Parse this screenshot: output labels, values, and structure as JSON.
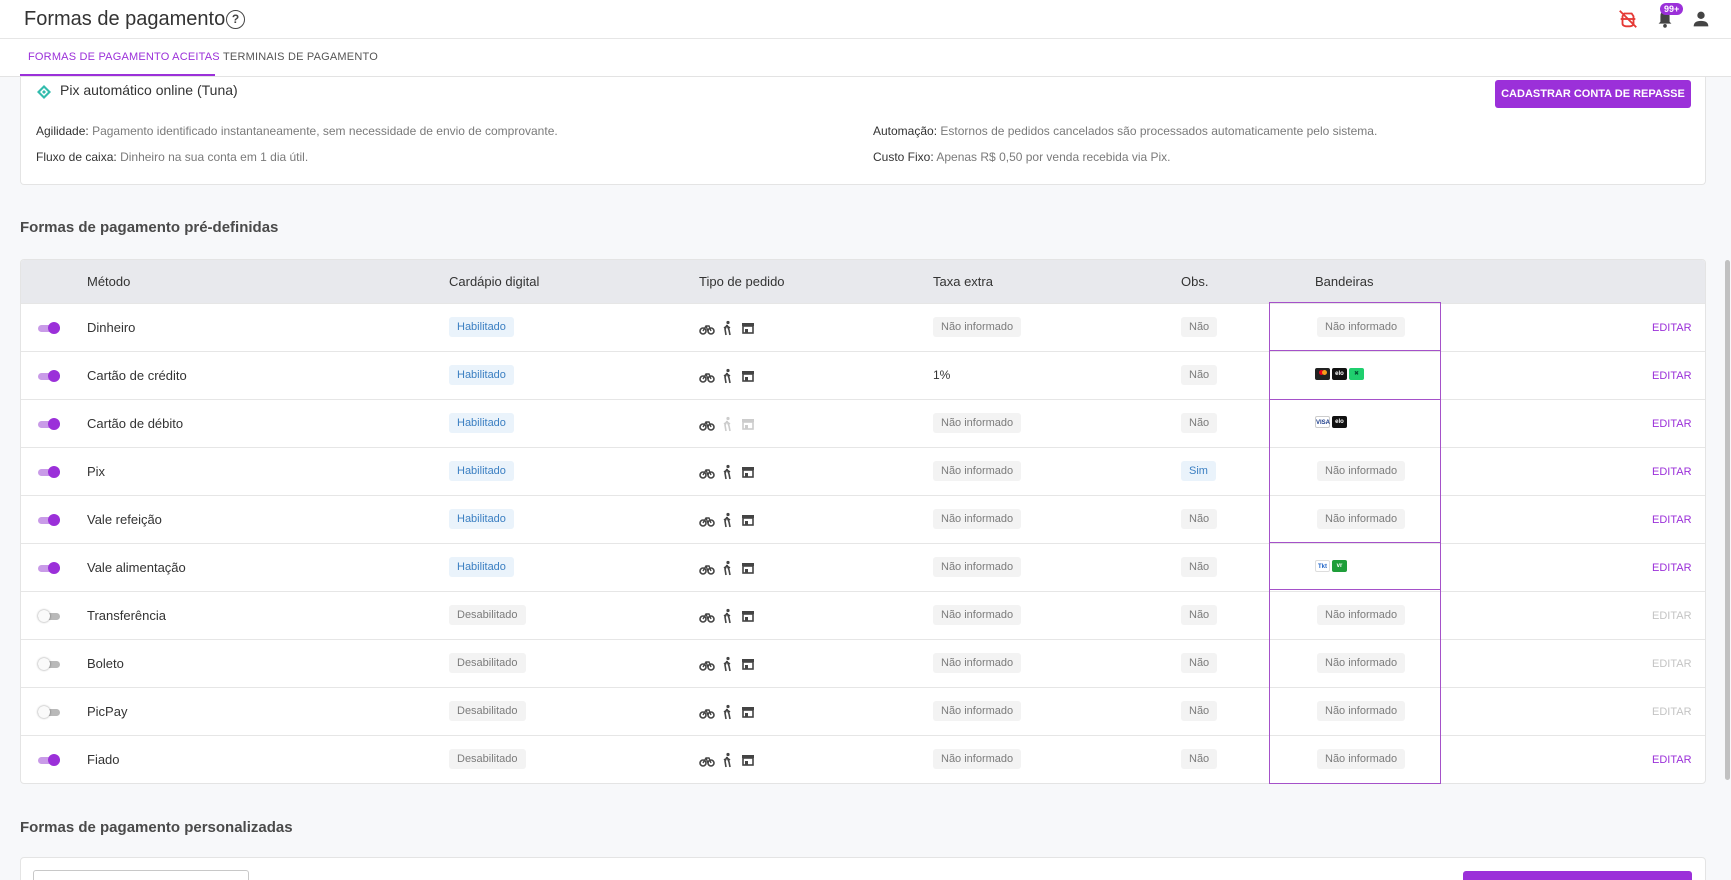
{
  "header": {
    "title": "Formas de pagamento",
    "notification_count": "99+"
  },
  "tabs": [
    {
      "label": "FORMAS DE PAGAMENTO ACEITAS",
      "active": true
    },
    {
      "label": "TERMINAIS DE PAGAMENTO",
      "active": false
    }
  ],
  "pix_card": {
    "title": "Pix automático online (Tuna)",
    "button": "CADASTRAR CONTA DE REPASSE",
    "info": [
      {
        "label": "Agilidade:",
        "value": "Pagamento identificado instantaneamente, sem necessidade de envio de comprovante."
      },
      {
        "label": "Fluxo de caixa:",
        "value": "Dinheiro na sua conta em 1 dia útil."
      },
      {
        "label": "Automação:",
        "value": "Estornos de pedidos cancelados são processados automaticamente pelo sistema."
      },
      {
        "label": "Custo Fixo:",
        "value": "Apenas R$ 0,50 por venda recebida via Pix."
      }
    ]
  },
  "predefined": {
    "title": "Formas de pagamento pré-definidas",
    "columns": [
      "Método",
      "Cardápio digital",
      "Tipo de pedido",
      "Taxa extra",
      "Obs.",
      "Bandeiras"
    ],
    "rows": [
      {
        "enabled": true,
        "method": "Dinheiro",
        "menu": "Habilitado",
        "types": [
          true,
          true,
          true
        ],
        "tax": "Não informado",
        "tax_chip": true,
        "obs": "Não",
        "brands_text": "Não informado",
        "brands": [],
        "edit": "EDITAR"
      },
      {
        "enabled": true,
        "method": "Cartão de crédito",
        "menu": "Habilitado",
        "types": [
          true,
          true,
          true
        ],
        "tax": "1%",
        "tax_chip": false,
        "obs": "Não",
        "brands_text": "",
        "brands": [
          "mastercard-icon",
          "elo-icon",
          "green-card-icon"
        ],
        "edit": "EDITAR"
      },
      {
        "enabled": true,
        "method": "Cartão de débito",
        "menu": "Habilitado",
        "types": [
          true,
          false,
          false
        ],
        "tax": "Não informado",
        "tax_chip": true,
        "obs": "Não",
        "brands_text": "",
        "brands": [
          "visa-icon",
          "elo-icon"
        ],
        "edit": "EDITAR"
      },
      {
        "enabled": true,
        "method": "Pix",
        "menu": "Habilitado",
        "types": [
          true,
          true,
          true
        ],
        "tax": "Não informado",
        "tax_chip": true,
        "obs": "Sim",
        "brands_text": "Não informado",
        "brands": [],
        "edit": "EDITAR"
      },
      {
        "enabled": true,
        "method": "Vale refeição",
        "menu": "Habilitado",
        "types": [
          true,
          true,
          true
        ],
        "tax": "Não informado",
        "tax_chip": true,
        "obs": "Não",
        "brands_text": "Não informado",
        "brands": [],
        "edit": "EDITAR"
      },
      {
        "enabled": true,
        "method": "Vale alimentação",
        "menu": "Habilitado",
        "types": [
          true,
          true,
          true
        ],
        "tax": "Não informado",
        "tax_chip": true,
        "obs": "Não",
        "brands_text": "",
        "brands": [
          "ticket-icon",
          "vr-icon"
        ],
        "edit": "EDITAR"
      },
      {
        "enabled": false,
        "method": "Transferência",
        "menu": "Desabilitado",
        "types": [
          true,
          true,
          true
        ],
        "tax": "Não informado",
        "tax_chip": true,
        "obs": "Não",
        "brands_text": "Não informado",
        "brands": [],
        "edit": "EDITAR"
      },
      {
        "enabled": false,
        "method": "Boleto",
        "menu": "Desabilitado",
        "types": [
          true,
          true,
          true
        ],
        "tax": "Não informado",
        "tax_chip": true,
        "obs": "Não",
        "brands_text": "Não informado",
        "brands": [],
        "edit": "EDITAR"
      },
      {
        "enabled": false,
        "method": "PicPay",
        "menu": "Desabilitado",
        "types": [
          true,
          true,
          true
        ],
        "tax": "Não informado",
        "tax_chip": true,
        "obs": "Não",
        "brands_text": "Não informado",
        "brands": [],
        "edit": "EDITAR"
      },
      {
        "enabled": true,
        "method": "Fiado",
        "menu": "Desabilitado",
        "types": [
          true,
          true,
          true
        ],
        "tax": "Não informado",
        "tax_chip": true,
        "obs": "Não",
        "brands_text": "Não informado",
        "brands": [],
        "edit": "EDITAR"
      }
    ]
  },
  "custom": {
    "title": "Formas de pagamento personalizadas"
  },
  "colors": {
    "accent": "#9b30d9",
    "enabled_chip": "#3b7fc2"
  }
}
